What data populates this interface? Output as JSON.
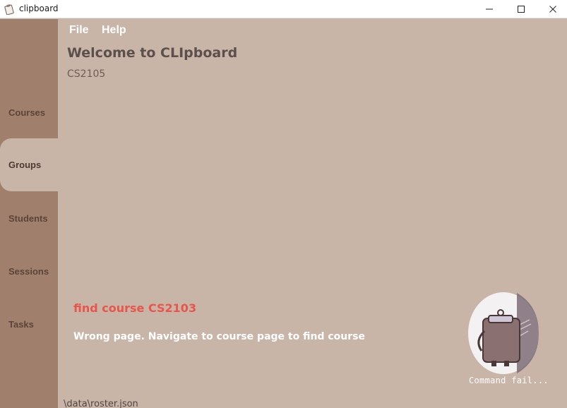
{
  "window": {
    "title": "clipboard",
    "controls": [
      "minimize",
      "maximize",
      "close"
    ]
  },
  "sidebar": {
    "items": [
      {
        "label": "Courses",
        "active": false
      },
      {
        "label": "Groups",
        "active": true
      },
      {
        "label": "Students",
        "active": false
      },
      {
        "label": "Sessions",
        "active": false
      },
      {
        "label": "Tasks",
        "active": false
      }
    ]
  },
  "menubar": {
    "file_label": "File",
    "help_label": "Help"
  },
  "main": {
    "title": "Welcome to CLIpboard",
    "subtitle": "CS2105",
    "command": "find course CS2103",
    "result": "Wrong page. Navigate to course page to find course",
    "mascot_caption": "Command fail..."
  },
  "status": {
    "path": "\\data\\roster.json"
  },
  "colors": {
    "sidebar_bg": "#a0806d",
    "main_bg": "#c9b5a8",
    "command_text": "#e8564a",
    "result_text": "#ffffff"
  },
  "icons": {
    "app": "clipboard-icon",
    "minimize": "minimize-icon",
    "maximize": "maximize-icon",
    "close": "close-icon",
    "mascot": "clipboard-mascot-icon"
  }
}
